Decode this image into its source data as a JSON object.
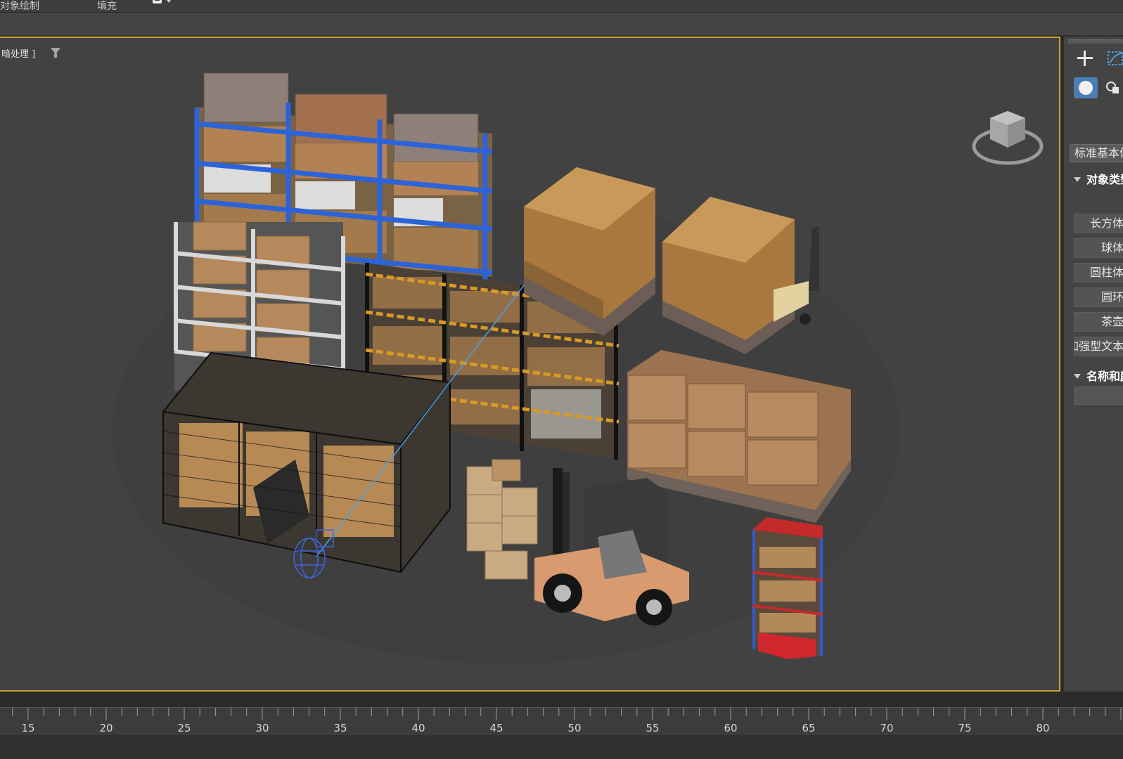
{
  "topbar": {
    "menu_object_paint": "对象绘制",
    "menu_fill": "填充"
  },
  "viewport": {
    "label": "暗处理 ]",
    "active_border_color": "#c2a23a",
    "background_color": "#424242"
  },
  "right_panel": {
    "create_icon": "plus-icon",
    "geometry_icon": "sphere-icon",
    "shapes_icon": "shapes-icon",
    "category_select": "标准基本体",
    "section_object_type": "对象类型",
    "buttons": [
      "长方体",
      "球体",
      "圆柱体",
      "圆环",
      "茶壶",
      "加强型文本"
    ],
    "section_name_color": "名称和颜色"
  },
  "timeline": {
    "ticks": [
      "15",
      "20",
      "25",
      "30",
      "35",
      "40",
      "45",
      "50",
      "55",
      "60",
      "65",
      "70",
      "75",
      "80"
    ]
  }
}
